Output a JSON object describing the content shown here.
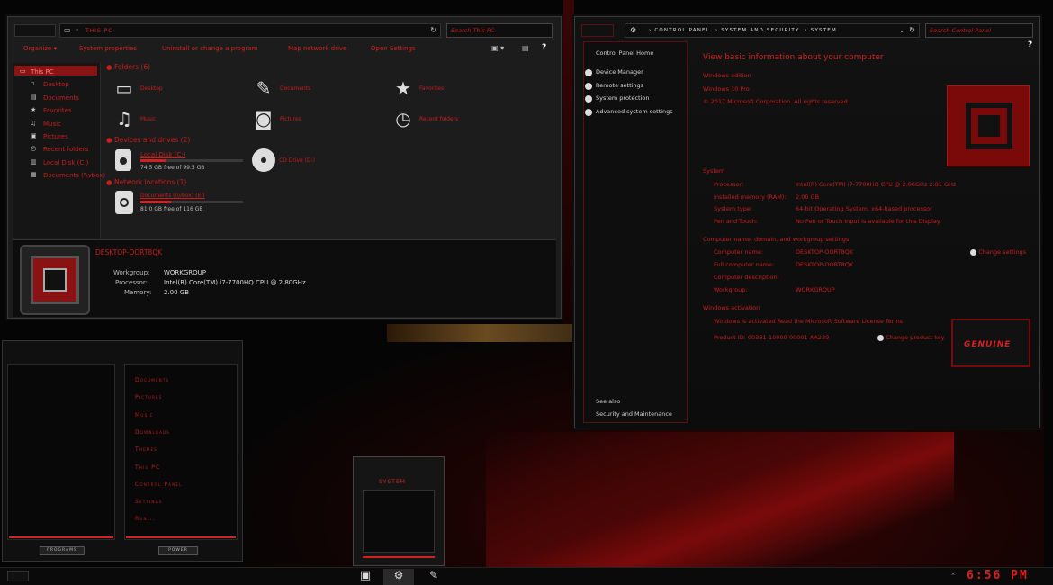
{
  "this_pc": {
    "title": "This PC",
    "search_placeholder": "Search This PC",
    "commands": [
      "Organize ▾",
      "System properties",
      "Uninstall or change a program",
      "Map network drive",
      "Open Settings"
    ],
    "sidebar": [
      {
        "label": "This PC",
        "icon": "computer-icon"
      },
      {
        "label": "Desktop",
        "icon": "desktop-icon"
      },
      {
        "label": "Documents",
        "icon": "document-icon"
      },
      {
        "label": "Favorites",
        "icon": "star-icon"
      },
      {
        "label": "Music",
        "icon": "music-icon"
      },
      {
        "label": "Pictures",
        "icon": "picture-icon"
      },
      {
        "label": "Recent folders",
        "icon": "recent-icon"
      },
      {
        "label": "Local Disk (C:)",
        "icon": "disk-icon"
      },
      {
        "label": "Documents (\\\\vbox)",
        "icon": "network-drive-icon"
      }
    ],
    "folders_header": "Folders (6)",
    "folders": [
      {
        "label": "Desktop",
        "icon": "monitor-icon"
      },
      {
        "label": "Documents",
        "icon": "pencil-icon"
      },
      {
        "label": "Favorites",
        "icon": "star-icon"
      },
      {
        "label": "Music",
        "icon": "music-note-icon"
      },
      {
        "label": "Pictures",
        "icon": "camera-icon"
      },
      {
        "label": "Recent folders",
        "icon": "clock-run-icon"
      }
    ],
    "devices_header": "Devices and drives (2)",
    "local_disk": {
      "label": "Local Disk (C:)",
      "free": "74.5 GB free of 99.5 GB",
      "used_fraction": 0.25
    },
    "cd_drive": {
      "label": "CD Drive (D:)"
    },
    "network_header": "Network locations (1)",
    "network_drive": {
      "label": "Documents (\\\\vbox) (E:)",
      "free": "81.0 GB free of 116 GB",
      "used_fraction": 0.3
    },
    "details": {
      "pc_name": "DESKTOP-OORT8QK",
      "workgroup_label": "Workgroup:",
      "workgroup_value": "WORKGROUP",
      "processor_label": "Processor:",
      "processor_value": "Intel(R) Core(TM) i7-7700HQ CPU @ 2.80GHz",
      "memory_label": "Memory:",
      "memory_value": "2.00 GB"
    }
  },
  "system": {
    "breadcrumb": [
      "Control Panel",
      "System and Security",
      "System"
    ],
    "search_placeholder": "Search Control Panel",
    "help": "?",
    "sidebar_home": "Control Panel Home",
    "sidebar_links": [
      "Device Manager",
      "Remote settings",
      "System protection",
      "Advanced system settings"
    ],
    "see_also": "See also",
    "see_also_link": "Security and Maintenance",
    "heading": "View basic information about your computer",
    "edition_header": "Windows edition",
    "edition": "Windows 10 Pro",
    "copyright": "© 2017 Microsoft Corporation. All rights reserved.",
    "system_header": "System",
    "system_rows": [
      {
        "k": "Processor:",
        "v": "Intel(R) Core(TM) i7-7700HQ CPU @ 2.80GHz   2.81 GHz"
      },
      {
        "k": "Installed memory (RAM):",
        "v": "2.00 GB"
      },
      {
        "k": "System type:",
        "v": "64-bit Operating System, x64-based processor"
      },
      {
        "k": "Pen and Touch:",
        "v": "No Pen or Touch Input is available for this Display"
      }
    ],
    "name_header": "Computer name, domain, and workgroup settings",
    "name_rows": [
      {
        "k": "Computer name:",
        "v": "DESKTOP-OORT8QK"
      },
      {
        "k": "Full computer name:",
        "v": "DESKTOP-OORT8QK"
      },
      {
        "k": "Computer description:",
        "v": ""
      },
      {
        "k": "Workgroup:",
        "v": "WORKGROUP"
      }
    ],
    "change_settings": "Change settings",
    "activation_header": "Windows activation",
    "activation_status": "Windows is activated   Read the Microsoft Software License Terms",
    "product_id": "Product ID: 00331-10000-00001-AA239",
    "change_key": "Change product key",
    "genuine": "GENUINE"
  },
  "start_menu": {
    "items": [
      "Documents",
      "Pictures",
      "Music",
      "Downloads",
      "Themes",
      "This PC",
      "Control Panel",
      "Settings",
      "Run..."
    ],
    "programs_button": "PROGRAMS",
    "power_button": "POWER"
  },
  "taskbar": {
    "preview_title": "System",
    "clock": "6:56 PM",
    "tray_arrow": "⌃"
  }
}
